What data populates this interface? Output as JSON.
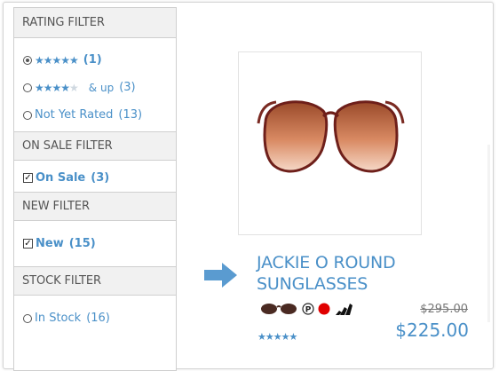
{
  "filters": {
    "rating": {
      "header": "RATING FILTER",
      "options": [
        {
          "stars_filled": 5,
          "label": "",
          "count": "(1)",
          "selected": true
        },
        {
          "stars_filled": 4,
          "label": "& up",
          "count": "(3)",
          "selected": false
        },
        {
          "label": "Not Yet Rated",
          "count": "(13)",
          "selected": false
        }
      ]
    },
    "on_sale": {
      "header": "ON SALE FILTER",
      "option": {
        "label": "On Sale",
        "count": "(3)",
        "checked": true
      }
    },
    "new": {
      "header": "NEW FILTER",
      "option": {
        "label": "New",
        "count": "(15)",
        "checked": true
      }
    },
    "stock": {
      "header": "STOCK FILTER",
      "option": {
        "label": "In Stock",
        "count": "(16)",
        "selected": false
      }
    }
  },
  "product": {
    "title": "JACKIE O ROUND SUNGLASSES",
    "old_price": "$295.00",
    "price": "$225.00",
    "rating_stars": 5,
    "swatches": [
      "sunglasses-thumb-icon",
      "parking-p-icon",
      "red-dot-icon",
      "adidas-logo-icon"
    ]
  },
  "colors": {
    "accent": "#4a90c8",
    "header_bg": "#f1f1f1",
    "arrow": "#5a9bd0",
    "swatch_red": "#e00000"
  }
}
